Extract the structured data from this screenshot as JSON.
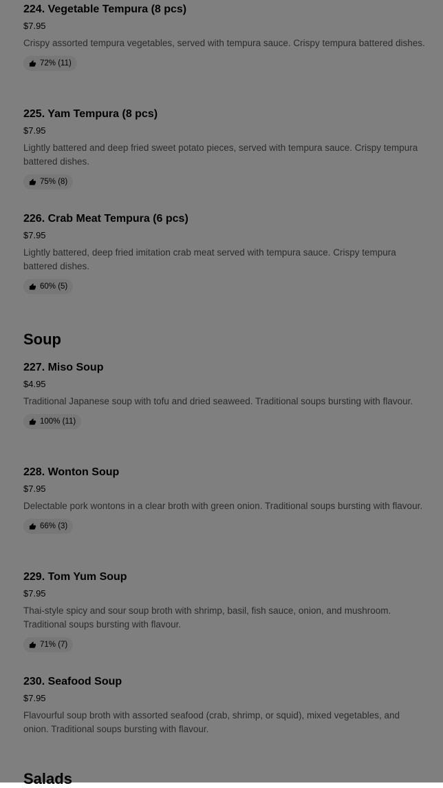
{
  "colors": {
    "overlay": "rgba(0,0,0,0.5)",
    "chip_bg": "#eeeeee",
    "desc_text": "#545454"
  },
  "icons": {
    "rating": "thumbs-up-icon"
  },
  "items_a": [
    {
      "name": "224. Vegetable Tempura (8 pcs)",
      "price": "$7.95",
      "description": "Crispy assorted tempura vegetables, served with tempura sauce. Crispy tempura battered dishes.",
      "rating": "72% (11)"
    },
    {
      "name": "225. Yam Tempura (8 pcs)",
      "price": "$7.95",
      "description": "Lightly battered and deep fried sweet potato pieces, served with tempura sauce. Crispy tempura battered dishes.",
      "rating": "75% (8)"
    },
    {
      "name": "226. Crab Meat Tempura (6 pcs)",
      "price": "$7.95",
      "description": "Lightly battered, deep fried imitation crab meat served with tempura sauce. Crispy tempura battered dishes.",
      "rating": "60% (5)"
    }
  ],
  "sections": {
    "soup": "Soup",
    "salads": "Salads"
  },
  "items_b": [
    {
      "name": "227. Miso Soup",
      "price": "$4.95",
      "description": "Traditional Japanese soup with tofu and dried seaweed. Traditional soups bursting with flavour.",
      "rating": "100% (11)"
    },
    {
      "name": "228. Wonton Soup",
      "price": "$7.95",
      "description": "Delectable pork wontons in a clear broth with green onion. Traditional soups bursting with flavour.",
      "rating": "66% (3)"
    },
    {
      "name": "229. Tom Yum Soup",
      "price": "$7.95",
      "description": "Thai-style spicy and sour soup broth with shrimp, basil, fish sauce, onion, and mushroom. Traditional soups bursting with flavour.",
      "rating": "71% (7)"
    },
    {
      "name": "230. Seafood Soup",
      "price": "$7.95",
      "description": "Flavourful soup broth with assorted seafood (crab, shrimp, or squid), mixed vegetables, and onion. Traditional soups bursting with flavour."
    }
  ]
}
